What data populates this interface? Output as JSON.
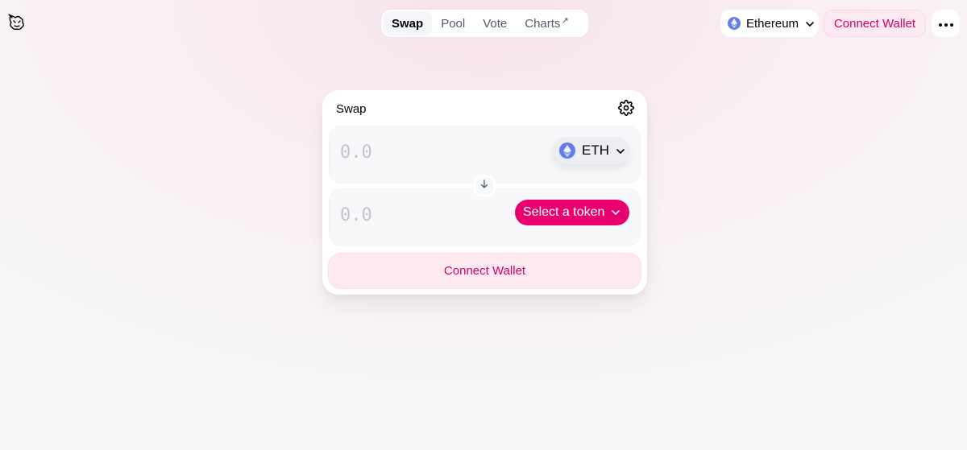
{
  "nav": {
    "tabs": [
      {
        "label": "Swap",
        "active": true
      },
      {
        "label": "Pool",
        "active": false
      },
      {
        "label": "Vote",
        "active": false
      },
      {
        "label": "Charts",
        "active": false,
        "external": "↗"
      }
    ]
  },
  "header": {
    "network_label": "Ethereum",
    "connect_label": "Connect Wallet",
    "more_icon": "more-horizontal-icon",
    "logo_icon": "unicorn-logo-icon"
  },
  "swap": {
    "title": "Swap",
    "settings_icon": "gear-icon",
    "input": {
      "placeholder": "0.0",
      "token_symbol": "ETH"
    },
    "output": {
      "placeholder": "0.0",
      "select_label": "Select a token"
    },
    "arrow_icon": "arrow-down-icon",
    "connect_label": "Connect Wallet"
  },
  "colors": {
    "accent": "#e8006f",
    "accent_text": "#d50066",
    "accent_soft": "#fde9f0",
    "eth_blue": "#627eea"
  }
}
